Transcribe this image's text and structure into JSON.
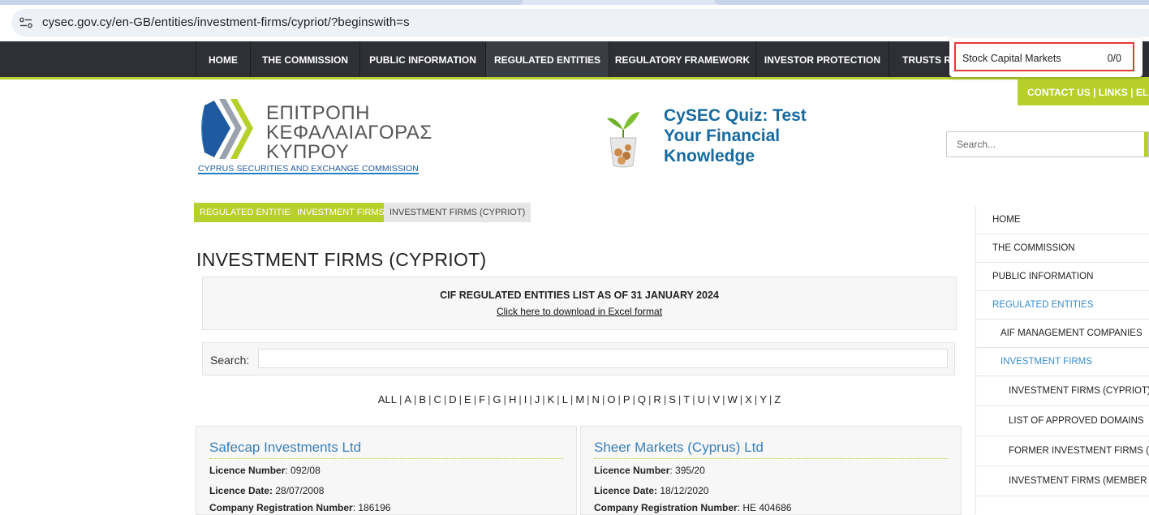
{
  "browser": {
    "url": "cysec.gov.cy/en-GB/entities/investment-firms/cypriot/?beginswith=s"
  },
  "nav": {
    "items": [
      {
        "label": "HOME"
      },
      {
        "label": "THE COMMISSION"
      },
      {
        "label": "PUBLIC INFORMATION"
      },
      {
        "label": "REGULATED ENTITIES",
        "active": true
      },
      {
        "label": "REGULATORY FRAMEWORK"
      },
      {
        "label": "INVESTOR PROTECTION"
      },
      {
        "label": "TRUSTS RE"
      }
    ]
  },
  "find": {
    "query": "Stock Capital Markets",
    "count": "0/0"
  },
  "contact_bar": {
    "text": "CONTACT US  |  LINKS  |   EL / E"
  },
  "logo": {
    "line1": "ΕΠΙΤΡΟΠΗ",
    "line2": "ΚΕΦΑΛΑΙΑΓΟΡΑΣ",
    "line3": "ΚΥΠΡΟΥ",
    "subtitle": "CYPRUS SECURITIES AND EXCHANGE COMMISSION",
    "brand_color": "#1f7fc2",
    "accent_color": "#b7cf2a"
  },
  "quiz": {
    "text": "CySEC Quiz: Test Your Financial Knowledge"
  },
  "header_search": {
    "placeholder": "Search..."
  },
  "breadcrumb": [
    {
      "label": "REGULATED ENTITIES"
    },
    {
      "label": "INVESTMENT FIRMS"
    },
    {
      "label": "INVESTMENT FIRMS (CYPRIOT)"
    }
  ],
  "page": {
    "title": "INVESTMENT FIRMS (CYPRIOT)",
    "list_title": "CIF REGULATED ENTITIES LIST AS OF 31 JANUARY 2024",
    "download_link": "Click here to download in Excel format",
    "search_label": "Search:"
  },
  "alphabet": [
    "ALL",
    "A",
    "B",
    "C",
    "D",
    "E",
    "F",
    "G",
    "H",
    "I",
    "J",
    "K",
    "L",
    "M",
    "N",
    "O",
    "P",
    "Q",
    "R",
    "S",
    "T",
    "U",
    "V",
    "W",
    "X",
    "Y",
    "Z"
  ],
  "cards": [
    {
      "name": "Safecap Investments Ltd",
      "licence_number_label": "Licence Number",
      "licence_number": ": 092/08",
      "licence_date_label": "Licence Date:",
      "licence_date": " 28/07/2008",
      "reg_label": "Company Registration Number",
      "reg_value": ": 186196"
    },
    {
      "name": "Sheer Markets (Cyprus) Ltd",
      "licence_number_label": "Licence Number",
      "licence_number": ": 395/20",
      "licence_date_label": "Licence Date:",
      "licence_date": " 18/12/2020",
      "reg_label": "Company Registration Number",
      "reg_value": ": HE 404686"
    }
  ],
  "sidebar": {
    "items": [
      {
        "label": "HOME",
        "level": 0
      },
      {
        "label": "THE COMMISSION",
        "level": 0
      },
      {
        "label": "PUBLIC INFORMATION",
        "level": 0
      },
      {
        "label": "REGULATED ENTITIES",
        "level": 0,
        "active": true
      },
      {
        "label": "AIF MANAGEMENT COMPANIES",
        "level": 1
      },
      {
        "label": "INVESTMENT FIRMS",
        "level": 1,
        "active": true
      },
      {
        "label": "INVESTMENT FIRMS (CYPRIOT)",
        "level": 2
      },
      {
        "label": "LIST OF APPROVED DOMAINS",
        "level": 2
      },
      {
        "label": "FORMER INVESTMENT FIRMS (CYPR",
        "level": 2
      },
      {
        "label": "INVESTMENT FIRMS (MEMBER STAT",
        "level": 2
      }
    ]
  }
}
